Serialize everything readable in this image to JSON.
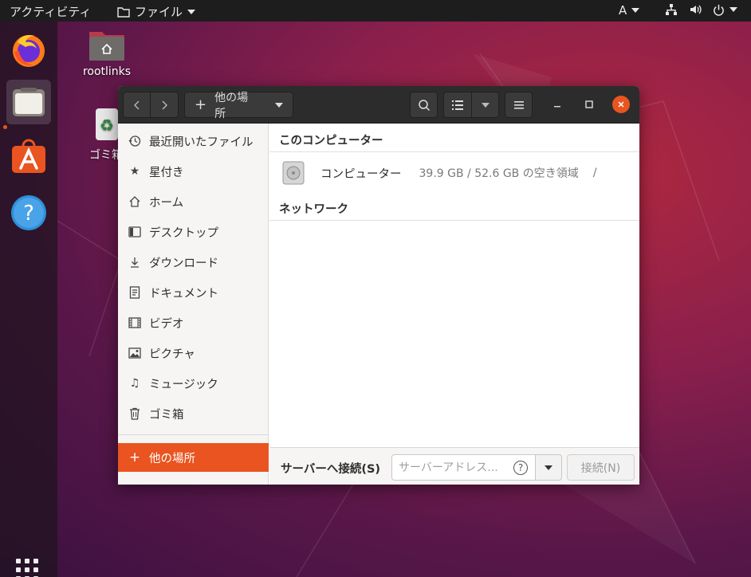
{
  "topbar": {
    "activities": "アクティビティ",
    "app_menu": "ファイル",
    "input_method": "A"
  },
  "desktop": {
    "home_folder_label": "rootlinks",
    "trash_label": "ゴミ箱"
  },
  "window": {
    "path_button": "他の場所"
  },
  "sidebar": {
    "items": [
      {
        "label": "最近開いたファイル",
        "icon": "recent-icon"
      },
      {
        "label": "星付き",
        "icon": "star-icon"
      },
      {
        "label": "ホーム",
        "icon": "home-icon"
      },
      {
        "label": "デスクトップ",
        "icon": "desktop-icon"
      },
      {
        "label": "ダウンロード",
        "icon": "download-icon"
      },
      {
        "label": "ドキュメント",
        "icon": "document-icon"
      },
      {
        "label": "ビデオ",
        "icon": "video-icon"
      },
      {
        "label": "ピクチャ",
        "icon": "picture-icon"
      },
      {
        "label": "ミュージック",
        "icon": "music-icon"
      },
      {
        "label": "ゴミ箱",
        "icon": "trash-icon"
      }
    ],
    "other_locations": "他の場所"
  },
  "main": {
    "this_computer_title": "このコンピューター",
    "computer": {
      "name": "コンピューター",
      "usage": "39.9 GB / 52.6 GB の空き領域",
      "path": "/"
    },
    "network_title": "ネットワーク"
  },
  "bottom": {
    "connect_label": "サーバーへ接続(S)",
    "server_placeholder": "サーバーアドレス...",
    "server_value": "",
    "connect_button": "接続(N)"
  },
  "colors": {
    "accent": "#e95420",
    "topbar": "#1d1d1d",
    "headerbar": "#2c2c2c"
  }
}
